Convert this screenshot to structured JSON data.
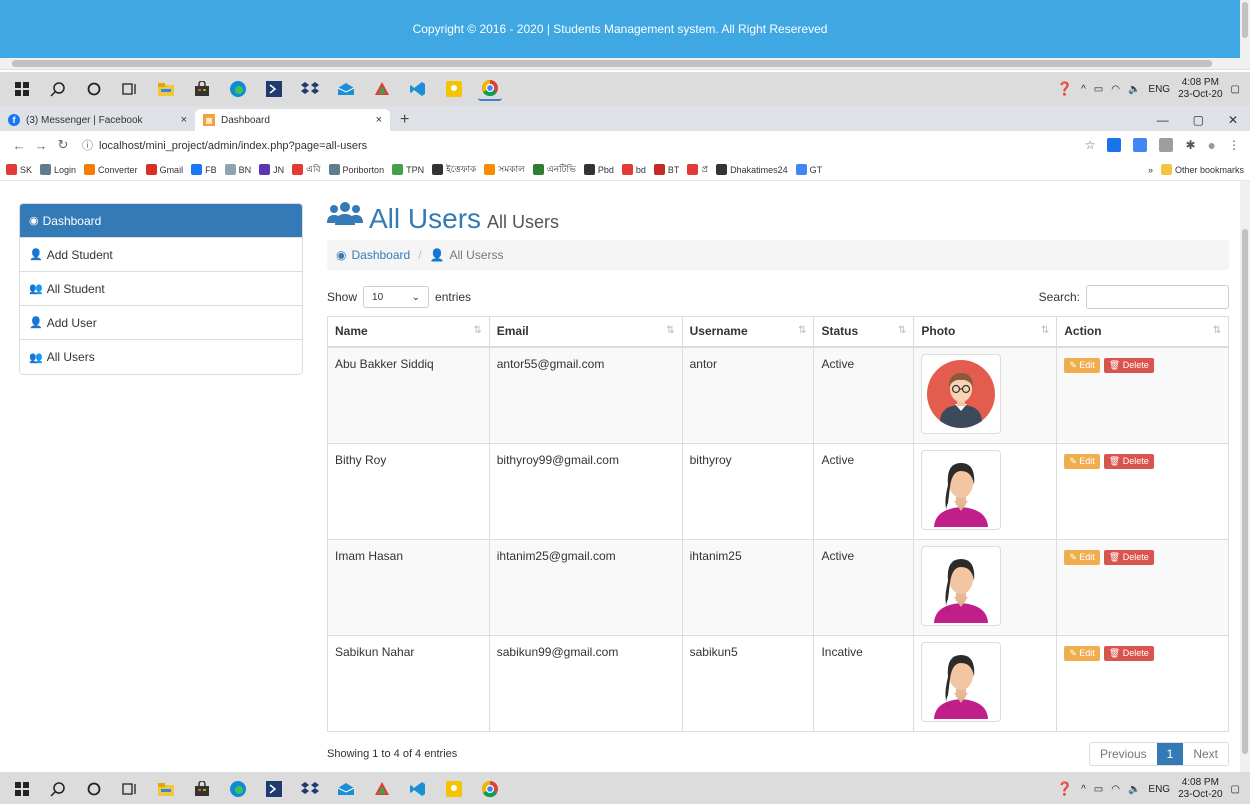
{
  "stale_footer": {
    "text": "Copyright © 2016 - 2020 | Students Management system. All Right Resereved"
  },
  "taskbar": {
    "language": "ENG",
    "time": "4:08 PM",
    "date": "23-Oct-20"
  },
  "browser": {
    "tabs": [
      {
        "label": "(3) Messenger | Facebook"
      },
      {
        "label": "Dashboard"
      }
    ],
    "url": "localhost/mini_project/admin/index.php?page=all-users",
    "bookmarks": [
      {
        "label": "SK",
        "color": "#e53935"
      },
      {
        "label": "Login",
        "color": "#607d8b"
      },
      {
        "label": "Converter",
        "color": "#f57c00"
      },
      {
        "label": "Gmail",
        "color": "#d93025"
      },
      {
        "label": "FB",
        "color": "#1877f2"
      },
      {
        "label": "BN",
        "color": "#90a4ae"
      },
      {
        "label": "JN",
        "color": "#5e35b1"
      },
      {
        "label": "এবি",
        "color": "#e53935"
      },
      {
        "label": "Poriborton",
        "color": "#607d8b"
      },
      {
        "label": "TPN",
        "color": "#43a047"
      },
      {
        "label": "ইত্তেফাক",
        "color": "#333333"
      },
      {
        "label": "সমকাল",
        "color": "#fb8c00"
      },
      {
        "label": "এনটিভি",
        "color": "#2e7d32"
      },
      {
        "label": "Pbd",
        "color": "#333333"
      },
      {
        "label": "bd",
        "color": "#e53935"
      },
      {
        "label": "BT",
        "color": "#c62828"
      },
      {
        "label": "প্র",
        "color": "#e53935"
      },
      {
        "label": "Dhakatimes24",
        "color": "#333333"
      },
      {
        "label": "GT",
        "color": "#4285f4"
      }
    ],
    "bookmarks_more": "»",
    "other_bookmarks": "Other bookmarks"
  },
  "sidebar": {
    "items": [
      {
        "label": "Dashboard",
        "icon": "dashboard-icon",
        "active": true
      },
      {
        "label": "Add Student",
        "icon": "user-plus-icon",
        "active": false
      },
      {
        "label": "All Student",
        "icon": "users-icon",
        "active": false
      },
      {
        "label": "Add User",
        "icon": "user-plus-icon",
        "active": false
      },
      {
        "label": "All Users",
        "icon": "users-icon",
        "active": false
      }
    ]
  },
  "page": {
    "title": "All Users",
    "subtitle": "All Users",
    "breadcrumb": {
      "home": "Dashboard",
      "current": "All Userss"
    }
  },
  "datatable": {
    "show_label": "Show",
    "entries_value": "10",
    "entries_label": "entries",
    "search_label": "Search:",
    "columns": [
      "Name",
      "Email",
      "Username",
      "Status",
      "Photo",
      "Action"
    ],
    "rows": [
      {
        "name": "Abu Bakker Siddiq",
        "email": "antor55@gmail.com",
        "username": "antor",
        "status": "Active",
        "avatar": "male"
      },
      {
        "name": "Bithy Roy",
        "email": "bithyroy99@gmail.com",
        "username": "bithyroy",
        "status": "Active",
        "avatar": "female"
      },
      {
        "name": "Imam Hasan",
        "email": "ihtanim25@gmail.com",
        "username": "ihtanim25",
        "status": "Active",
        "avatar": "female"
      },
      {
        "name": "Sabikun Nahar",
        "email": "sabikun99@gmail.com",
        "username": "sabikun5",
        "status": "Incative",
        "avatar": "female"
      }
    ],
    "edit_label": "Edit",
    "delete_label": "Delete",
    "info": "Showing 1 to 4 of 4 entries",
    "pager": {
      "prev": "Previous",
      "current": "1",
      "next": "Next"
    }
  },
  "colors": {
    "primary": "#337ab7",
    "footer": "#3fa7e1",
    "edit": "#f0ad4e",
    "delete": "#d9534f"
  }
}
